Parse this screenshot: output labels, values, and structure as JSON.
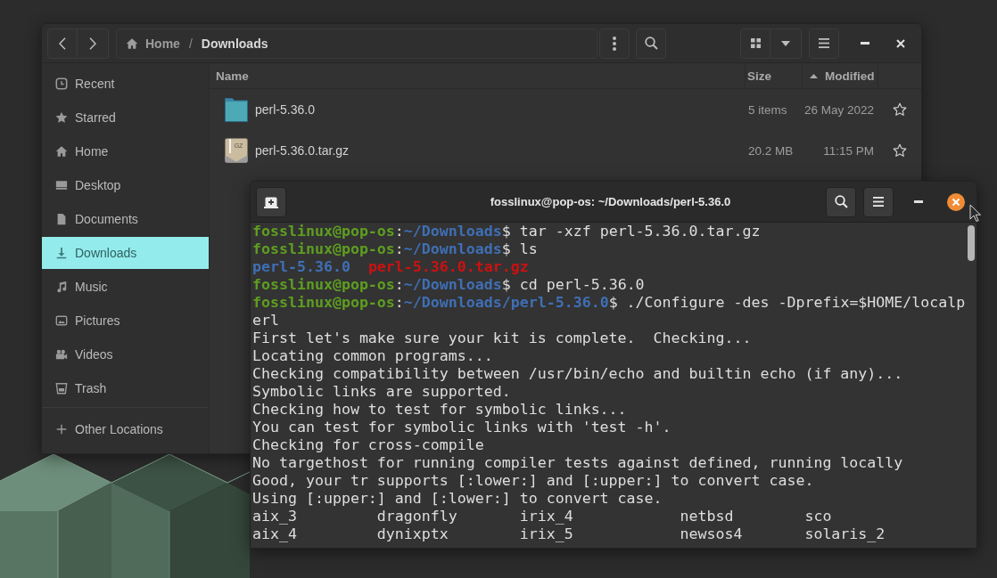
{
  "file_manager": {
    "breadcrumbs": [
      {
        "label": "Home",
        "selected": false
      },
      {
        "label": "Downloads",
        "selected": true
      }
    ],
    "breadcrumb_separator": "/",
    "sidebar": {
      "items": [
        {
          "label": "Recent",
          "kind": "recent",
          "selected": false
        },
        {
          "label": "Starred",
          "kind": "starred",
          "selected": false
        },
        {
          "label": "Home",
          "kind": "home",
          "selected": false
        },
        {
          "label": "Desktop",
          "kind": "desktop",
          "selected": false
        },
        {
          "label": "Documents",
          "kind": "documents",
          "selected": false
        },
        {
          "label": "Downloads",
          "kind": "downloads",
          "selected": true
        },
        {
          "label": "Music",
          "kind": "music",
          "selected": false
        },
        {
          "label": "Pictures",
          "kind": "pictures",
          "selected": false
        },
        {
          "label": "Videos",
          "kind": "videos",
          "selected": false
        },
        {
          "label": "Trash",
          "kind": "trash",
          "selected": false
        }
      ],
      "other_locations": {
        "label": "Other Locations"
      }
    },
    "columns": [
      {
        "label": "Name",
        "sorted": false
      },
      {
        "label": "Size",
        "sorted": false
      },
      {
        "label": "Modified",
        "sorted": true
      }
    ],
    "files": [
      {
        "name": "perl-5.36.0",
        "kind": "folder",
        "size": "5 items",
        "modified": "26 May 2022",
        "starred": false
      },
      {
        "name": "perl-5.36.0.tar.gz",
        "kind": "archive",
        "icon_text": "GZ",
        "size": "20.2 MB",
        "modified": "11:15 PM",
        "starred": false
      }
    ]
  },
  "terminal": {
    "title": "fosslinux@pop-os: ~/Downloads/perl-5.36.0",
    "lines": [
      {
        "kind": "prompt",
        "segments": [
          {
            "text": "fosslinux@pop-os",
            "kind": "user"
          },
          {
            "text": ":",
            "kind": "plain"
          },
          {
            "text": "~/Downloads",
            "kind": "path"
          },
          {
            "text": "$ tar -xzf perl-5.36.0.tar.gz",
            "kind": "plain"
          }
        ]
      },
      {
        "kind": "prompt",
        "segments": [
          {
            "text": "fosslinux@pop-os",
            "kind": "user"
          },
          {
            "text": ":",
            "kind": "plain"
          },
          {
            "text": "~/Downloads",
            "kind": "path"
          },
          {
            "text": "$ ls",
            "kind": "plain"
          }
        ]
      },
      {
        "kind": "listing",
        "segments": [
          {
            "text": "perl-5.36.0",
            "kind": "directory"
          },
          {
            "text": "perl-5.36.0.tar.gz",
            "kind": "archive"
          }
        ]
      },
      {
        "kind": "prompt",
        "segments": [
          {
            "text": "fosslinux@pop-os",
            "kind": "user"
          },
          {
            "text": ":",
            "kind": "plain"
          },
          {
            "text": "~/Downloads",
            "kind": "path"
          },
          {
            "text": "$ cd perl-5.36.0",
            "kind": "plain"
          }
        ]
      },
      {
        "kind": "prompt",
        "segments": [
          {
            "text": "fosslinux@pop-os",
            "kind": "user"
          },
          {
            "text": ":",
            "kind": "plain"
          },
          {
            "text": "~/Downloads/perl-5.36.0",
            "kind": "path"
          },
          {
            "text": "$ ./Configure -des -Dprefix=$HOME/localp",
            "kind": "plain"
          }
        ]
      },
      {
        "kind": "output",
        "text": "erl"
      },
      {
        "kind": "output",
        "text": "First let's make sure your kit is complete.  Checking..."
      },
      {
        "kind": "output",
        "text": "Locating common programs..."
      },
      {
        "kind": "output",
        "text": "Checking compatibility between /usr/bin/echo and builtin echo (if any)..."
      },
      {
        "kind": "output",
        "text": "Symbolic links are supported."
      },
      {
        "kind": "output",
        "text": "Checking how to test for symbolic links..."
      },
      {
        "kind": "output",
        "text": "You can test for symbolic links with 'test -h'."
      },
      {
        "kind": "output",
        "text": "Checking for cross-compile"
      },
      {
        "kind": "output",
        "text": "No targethost for running compiler tests against defined, running locally"
      },
      {
        "kind": "output",
        "text": "Good, your tr supports [:lower:] and [:upper:] to convert case."
      },
      {
        "kind": "output",
        "text": "Using [:upper:] and [:lower:] to convert case."
      },
      {
        "kind": "output",
        "text": "aix_3         dragonfly       irix_4            netbsd        sco"
      },
      {
        "kind": "output",
        "text": "aix_4         dynixptx        irix_5            newsos4       solaris_2"
      }
    ]
  }
}
